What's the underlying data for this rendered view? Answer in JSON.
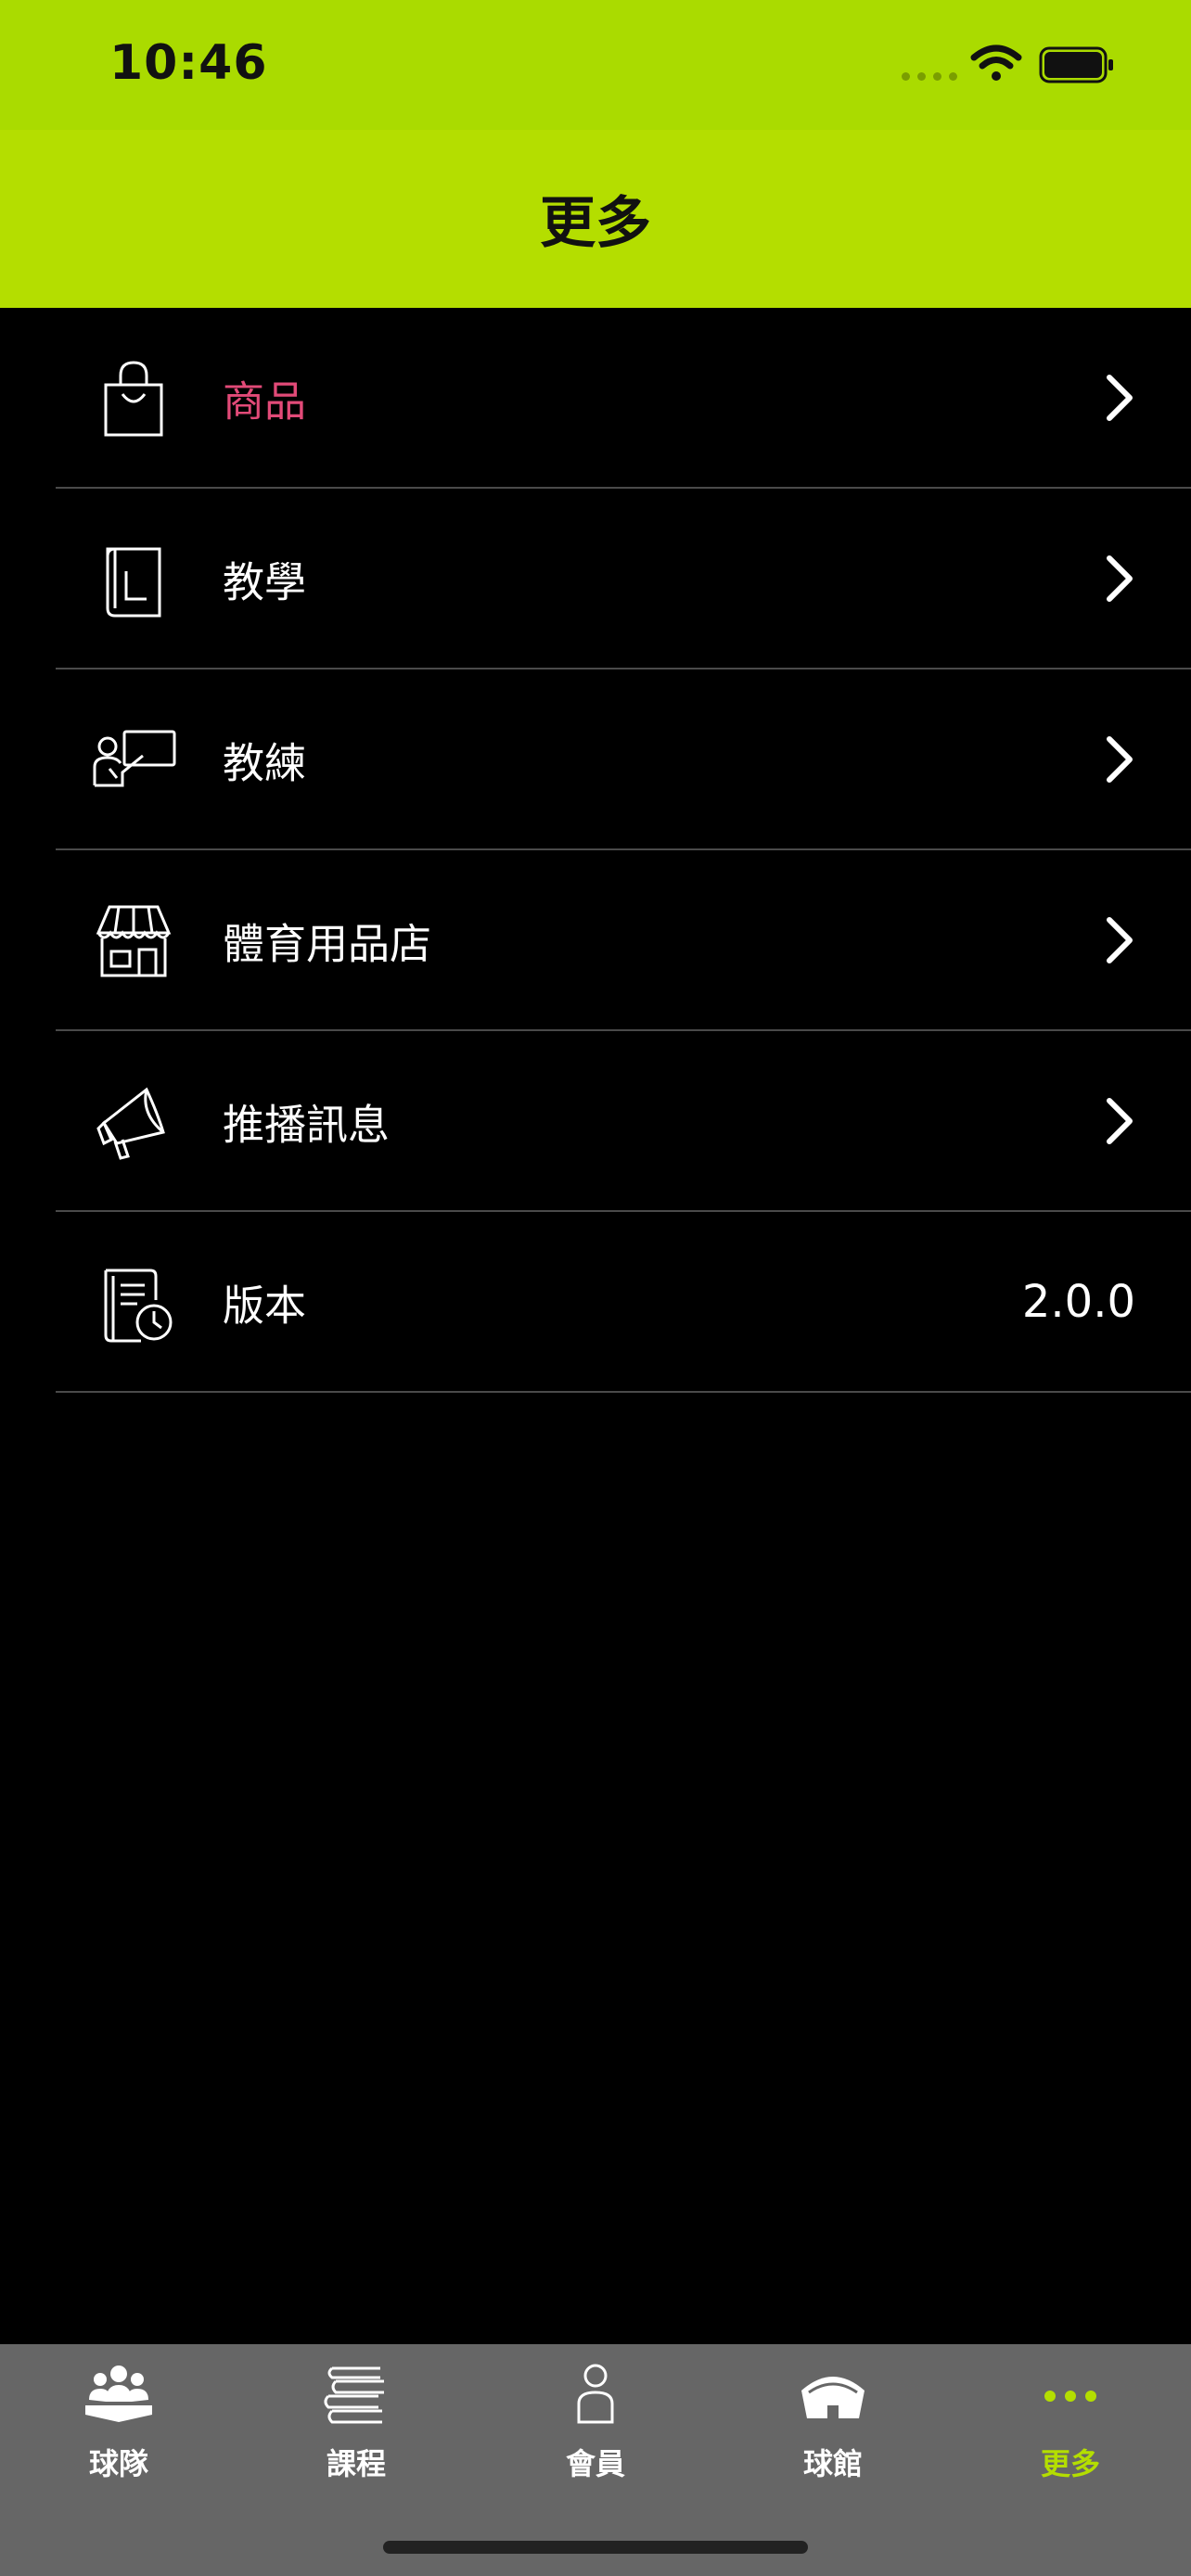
{
  "status": {
    "time": "10:46"
  },
  "header": {
    "title": "更多"
  },
  "colors": {
    "accent": "#b4de00",
    "highlight": "#e24a78",
    "background": "#000000",
    "tabbar": "#666666"
  },
  "menu": [
    {
      "label": "商品",
      "icon": "shopping-bag-icon",
      "highlight": true
    },
    {
      "label": "教學",
      "icon": "book-icon"
    },
    {
      "label": "教練",
      "icon": "coach-board-icon"
    },
    {
      "label": "體育用品店",
      "icon": "store-icon"
    },
    {
      "label": "推播訊息",
      "icon": "megaphone-icon"
    },
    {
      "label": "版本",
      "icon": "document-clock-icon",
      "value": "2.0.0"
    }
  ],
  "tabs": [
    {
      "label": "球隊",
      "icon": "team-icon"
    },
    {
      "label": "課程",
      "icon": "books-icon"
    },
    {
      "label": "會員",
      "icon": "person-icon"
    },
    {
      "label": "球館",
      "icon": "stadium-icon"
    },
    {
      "label": "更多",
      "icon": "more-dots-icon",
      "active": true
    }
  ]
}
